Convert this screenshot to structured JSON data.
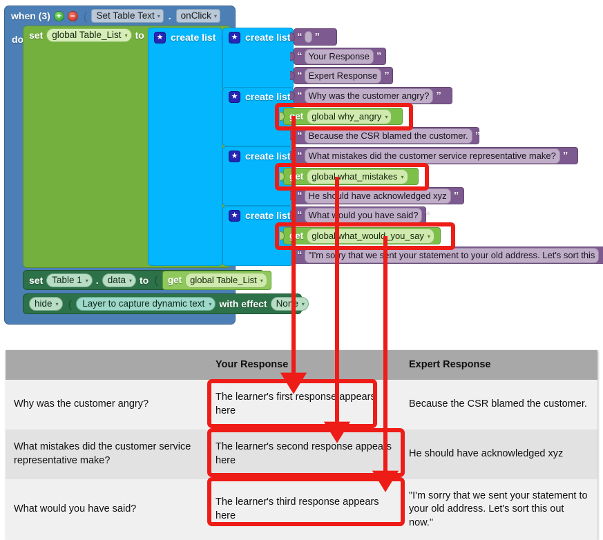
{
  "editor": {
    "event_block": {
      "when_label": "when (3)",
      "mutator_add": "+",
      "mutator_remove": "−",
      "component": "Set Table Text",
      "dot": ".",
      "event": "onClick",
      "do_label": "do"
    },
    "set_global": {
      "set_label": "set",
      "variable": "global Table_List",
      "to_label": "to"
    },
    "create_list_label": "create list",
    "star_glyph": "★",
    "text_blocks": [
      {
        "id": "empty",
        "value": ""
      },
      {
        "id": "your_resp",
        "value": "Your Response"
      },
      {
        "id": "expert_resp",
        "value": "Expert Response"
      },
      {
        "id": "q1",
        "value": "Why was the customer angry?"
      },
      {
        "id": "a1",
        "value": "Because the CSR blamed the customer."
      },
      {
        "id": "q2",
        "value": "What mistakes did the customer service representative make?"
      },
      {
        "id": "a2",
        "value": "He should have acknowledged xyz"
      },
      {
        "id": "q3",
        "value": "What would you have said?"
      },
      {
        "id": "a3",
        "value": "\"I'm sorry that we sent your statement to your old address. Let's sort this"
      }
    ],
    "get_blocks": [
      {
        "id": "g1",
        "get_label": "get",
        "variable": "global why_angry"
      },
      {
        "id": "g2",
        "get_label": "get",
        "variable": "global what_mistakes"
      },
      {
        "id": "g3",
        "get_label": "get",
        "variable": "global what_would_you_say"
      }
    ],
    "set_table_data": {
      "set_label": "set",
      "component": "Table 1",
      "dot": ".",
      "property": "data",
      "to_label": "to",
      "get_label": "get",
      "variable": "global Table_List"
    },
    "hide_block": {
      "action": "hide",
      "target": "Layer to capture dynamic text",
      "with_effect_label": "with effect",
      "effect": "None"
    },
    "quote_open": "“",
    "quote_close": "”",
    "caret": "▾"
  },
  "table": {
    "headers": [
      "",
      "Your Response",
      "Expert Response"
    ],
    "rows": [
      {
        "question": "Why was the customer angry?",
        "your_response": "The learner's first response appears here",
        "expert_response": "Because the CSR blamed the customer."
      },
      {
        "question": "What mistakes did the customer service representative make?",
        "your_response": "The learner's second response appears here",
        "expert_response": "He should have acknowledged xyz"
      },
      {
        "question": "What would you have said?",
        "your_response": "The learner's third response appears here",
        "expert_response": "\"I'm sorry that we sent your statement to your old address. Let's sort this out now.\""
      }
    ]
  },
  "annotations": {
    "highlight_color": "#ee1c17",
    "note": "Red boxes highlight the three get-variable blocks and the three Your Response table cells; arrows connect each get block to its table cell."
  }
}
